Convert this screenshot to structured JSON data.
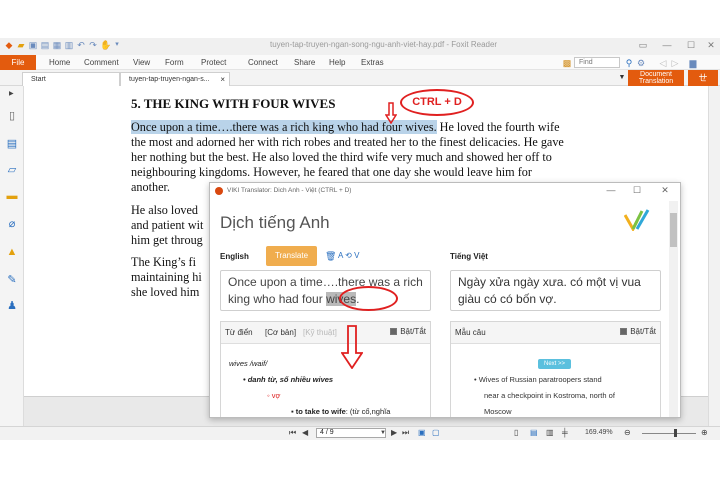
{
  "window": {
    "title": "tuyen-tap-truyen-ngan-song-ngu-anh-viet-hay.pdf - Foxit Reader",
    "buttons": [
      "▭",
      "—",
      "☐",
      "✕"
    ]
  },
  "menu": {
    "file": "File",
    "items": [
      "Home",
      "Comment",
      "View",
      "Form",
      "Protect",
      "Connect",
      "Share",
      "Help",
      "Extras"
    ],
    "find_placeholder": "Find",
    "doc_translation_line1": "Document",
    "doc_translation_line2": "Translation"
  },
  "tabs": [
    {
      "label": "Start"
    },
    {
      "label": "tuyen-tap-truyen-ngan-s...",
      "close": "×"
    }
  ],
  "document": {
    "heading": "5. THE KING WITH FOUR WIVES",
    "highlighted": "Once upon a time….there was a rich king who had four wives.",
    "lines": [
      " He loved the fourth wife",
      "the most and adorned her with rich robes and treated her to the finest delicacies. He gave",
      "her nothing but the best. He also loved the third wife very much and showed her off to",
      "neighbouring kingdoms. However, he feared that one day she would leave him for",
      "another.",
      "He also loved",
      "and patient wit",
      "him get throug",
      "The King’s fi",
      "maintaining hi",
      "she loved him"
    ]
  },
  "annotations": {
    "ctrl_d": "CTRL + D"
  },
  "translator": {
    "title": "VIKI Translator: Dich Anh - Việt (CTRL + D)",
    "header": "Dịch tiếng Anh",
    "source_lang": "English",
    "translate_button": "Translate",
    "swap_label": "A",
    "swap_v": "V",
    "target_lang": "Tiếng Việt",
    "source_text_before": "Once upon a time….there was a rich king who had four ",
    "source_word": "wives",
    "source_text_after": ".",
    "target_text": "Ngày xửa ngày xưa. có một vị vua giàu có có bốn vợ.",
    "dict_tab": "Từ điển",
    "dict_basic": "[Cơ bản]",
    "dict_tech": "[Kỹ thuật]",
    "toggle_label": "Bật/Tắt",
    "dict_entry": "wives /waif/",
    "dict_pos": "danh từ, số nhiều wives",
    "dict_meaning": "vợ",
    "dict_phrase_bold": "to take to wife",
    "dict_phrase_rest": ": (từ cổ,nghĩa",
    "examples_tab": "Mẫu câu",
    "next_button": "Next >>",
    "example_lines": [
      "Wives of Russian paratroopers stand",
      "near a checkpoint in Kostroma, north of",
      "Moscow"
    ]
  },
  "status": {
    "page_field": "4 / 9",
    "zoom": "169.49%"
  },
  "colors": {
    "accent_orange": "#e35b0e",
    "highlight_blue": "#b9d3e9",
    "annotation_red": "#e02020",
    "translate_button": "#f0ad4e",
    "next_button": "#5bc0de"
  }
}
